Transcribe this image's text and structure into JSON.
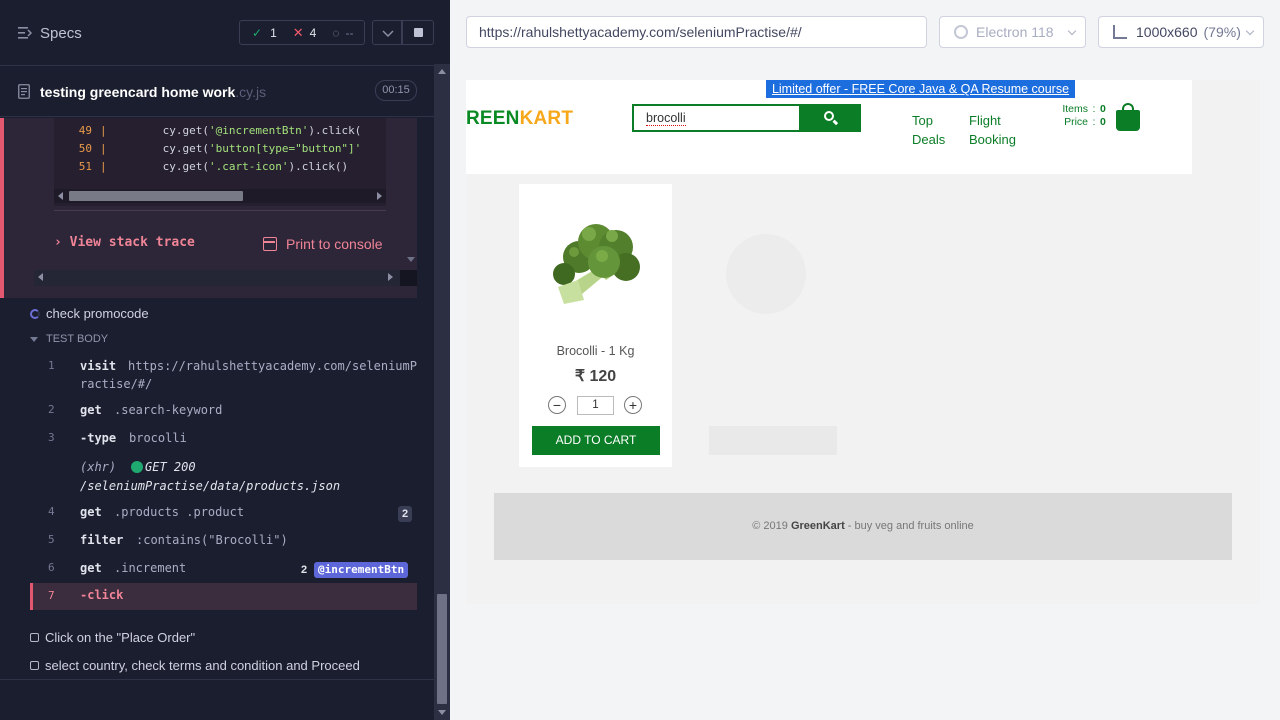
{
  "runner": {
    "specs_label": "Specs",
    "stats": {
      "passed": "1",
      "failed": "4",
      "pending": "--"
    },
    "spec": {
      "name": "testing greencard home work",
      "ext": ".cy.js",
      "duration": "00:15"
    },
    "code_frame": [
      {
        "line": "49",
        "pre": "cy.get(",
        "str": "'@incrementBtn'",
        "post": ").click("
      },
      {
        "line": "50",
        "pre": "cy.get(",
        "str": "'button[type=\"button\"]'",
        "post": ""
      },
      {
        "line": "51",
        "pre": "cy.get(",
        "str": "'.cart-icon'",
        "post": ").click()"
      }
    ],
    "view_stack_trace": "View stack trace",
    "print_to_console": "Print to console",
    "tests": {
      "promo": "check promocode",
      "test_body": "TEST BODY",
      "place_order": "Click on the \"Place Order\"",
      "country": "select country, check terms and condition and Proceed"
    },
    "commands": [
      {
        "num": "1",
        "name": "visit",
        "msg": "https://rahulshettyacademy.com/seleniumP",
        "msg2": "ractise/#/"
      },
      {
        "num": "2",
        "name": "get",
        "msg": ".search-keyword"
      },
      {
        "num": "3",
        "name": "-type",
        "msg": "brocolli"
      },
      {
        "xhr": "(xhr)",
        "status": "GET 200",
        "path": "/seleniumPractise/data/products.json"
      },
      {
        "num": "4",
        "name": "get",
        "msg": ".products .product",
        "badge": "2"
      },
      {
        "num": "5",
        "name": "filter",
        "msg": ":contains(\"Brocolli\")"
      },
      {
        "num": "6",
        "name": "get",
        "msg": ".increment",
        "badge": "2",
        "alias": "@incrementBtn"
      },
      {
        "num": "7",
        "name": "-click"
      }
    ]
  },
  "browser": {
    "url": "https://rahulshettyacademy.com/seleniumPractise/#/",
    "browser_name": "Electron 118",
    "viewport": "1000x660",
    "zoom": "(79%)"
  },
  "app": {
    "offer": "Limited offer - FREE Core Java & QA Resume course",
    "logo_green": "REEN",
    "logo_orange": "KART",
    "search_value": "brocolli",
    "nav_top": "Top",
    "nav_deals": "Deals",
    "nav_flight": "Flight",
    "nav_booking": "Booking",
    "items_label": "Items",
    "items_value": "0",
    "price_label": "Price",
    "price_value": "0",
    "colon": ":",
    "product": {
      "name": "Brocolli - 1 Kg",
      "price": "₹ 120",
      "qty": "1",
      "add_to_cart": "ADD TO CART"
    },
    "footer_prefix": "© 2019 ",
    "footer_brand": "GreenKart",
    "footer_suffix": " - buy veg and fruits online"
  },
  "colors": {
    "brand_green": "#0b7d27",
    "accent_orange": "#f6a71a",
    "error_red": "#e45770",
    "alias_purple": "#5d67d9"
  }
}
